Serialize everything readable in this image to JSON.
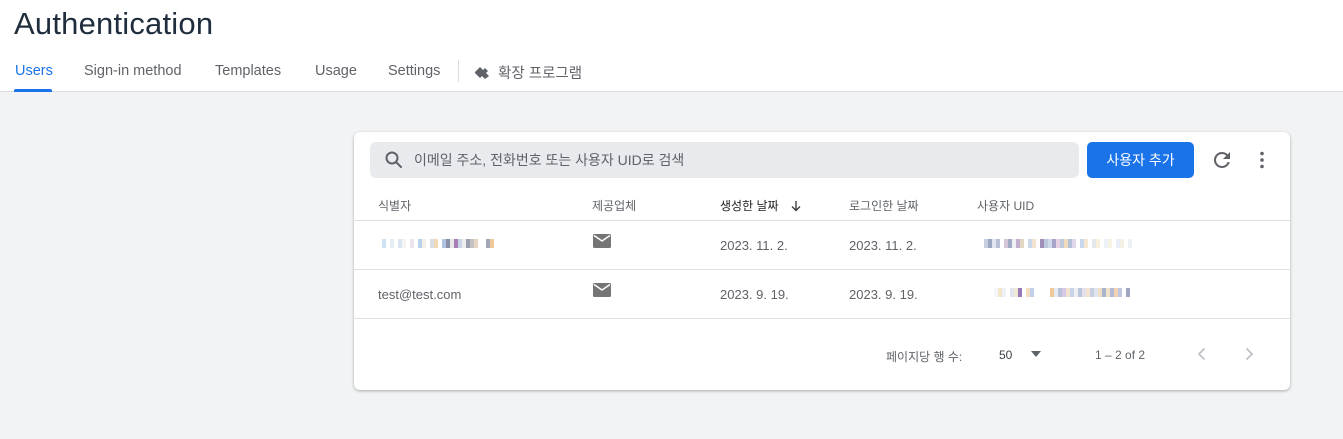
{
  "page": {
    "title": "Authentication"
  },
  "tabs": [
    {
      "label": "Users"
    },
    {
      "label": "Sign-in method"
    },
    {
      "label": "Templates"
    },
    {
      "label": "Usage"
    },
    {
      "label": "Settings"
    },
    {
      "label": "확장 프로그램"
    }
  ],
  "toolbar": {
    "search_placeholder": "이메일 주소, 전화번호 또는 사용자 UID로 검색",
    "add_user_label": "사용자 추가"
  },
  "table": {
    "columns": [
      "식별자",
      "제공업체",
      "생성한 날짜",
      "로그인한 날짜",
      "사용자 UID"
    ],
    "sorted_column": "생성한 날짜",
    "sort_direction": "descending",
    "rows": [
      {
        "identifier": "",
        "identifier_redacted": true,
        "provider": "email",
        "created": "2023. 11. 2.",
        "signed_in": "2023. 11. 2.",
        "uid_redacted": true
      },
      {
        "identifier": "test@test.com",
        "identifier_redacted": false,
        "provider": "email",
        "created": "2023. 9. 19.",
        "signed_in": "2023. 9. 19.",
        "uid_redacted": true
      }
    ]
  },
  "pagination": {
    "rows_per_page_label": "페이지당 행 수:",
    "rows_per_page": "50",
    "range": "1 – 2 of 2"
  },
  "colors": {
    "accent": "#1a73e8",
    "title": "#1f2d3d",
    "background": "#f1f3f4"
  },
  "icons": [
    "extensions-icon",
    "search-icon",
    "refresh-icon",
    "more-vert-icon",
    "sort-down-arrow-icon",
    "mail-icon",
    "dropdown-arrow-icon",
    "chevron-left-icon",
    "chevron-right-icon"
  ]
}
